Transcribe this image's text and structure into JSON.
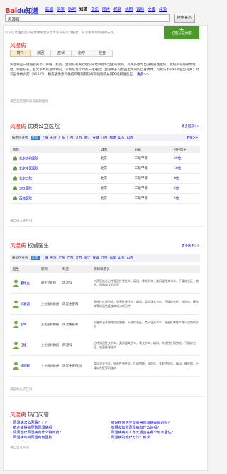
{
  "header": {
    "logo": {
      "bai": "Bai",
      "paw": "du",
      "zhidao": "知道"
    },
    "nav": [
      "新闻",
      "网页",
      "贴吧",
      "知道",
      "音乐",
      "图片",
      "视频",
      "地图",
      "百科",
      "文库",
      "经验"
    ],
    "current_nav": "知道",
    "search_value": "风湿病",
    "search_button": "搜索答案"
  },
  "intro": {
    "notice": "以下信息由百度知道健康联合多位专家权威信息整合，非常感谢对知道的支持。",
    "certify_plus": "+",
    "certify_label": "名医认证加帽",
    "title_red": "风湿病",
    "tabs": [
      "简介",
      "病因",
      "症状",
      "治疗",
      "检查"
    ],
    "description": "风湿病是一组侵犯关节、骨骼、肌肉、血管及有关软组织或结缔组织为主的疾病，其中多数为自身免疫性疾病。发病多较隐蔽而缓慢，病程较长，且大多具有遗传倾向。诊断及治疗均有一定难度；血液中多可检查出不同的自身抗体，可能与不同HLA亚型有关；对非甾体抗炎药（NSAID）、糖皮质激素和免疫抑制剂有较好的短期或长期的缓解性反应。",
    "more": "更多>>",
    "source": "来自百度百科权威编辑团队"
  },
  "hospitals": {
    "title_red": "风湿病",
    "title_rest": " 优质公立医院",
    "more": "更多医院>>",
    "filter_label": "按地区查找",
    "regions": [
      "北京",
      "上海",
      "天津",
      "广东",
      "广西",
      "江苏",
      "浙江",
      "安徽",
      "江西",
      "福建",
      "山东",
      "山西"
    ],
    "selected_region": "北京",
    "filter_more": "更多>>",
    "columns": [
      "医院",
      "城市",
      "分级",
      "好评医生"
    ],
    "rows": [
      {
        "name": "北京协和医院",
        "city": "北京",
        "level": "三级甲等",
        "docs": "29位"
      },
      {
        "name": "北京中医医院",
        "city": "北京",
        "level": "三级甲等",
        "docs": "10位"
      },
      {
        "name": "北京三院",
        "city": "北京",
        "level": "三级甲等",
        "docs": "8位"
      },
      {
        "name": "301医院",
        "city": "北京",
        "level": "三级甲等",
        "docs": "6位"
      },
      {
        "name": "西苑医院",
        "city": "北京",
        "level": "三级甲等",
        "docs": "5位"
      }
    ],
    "source": "来自好大夫在线"
  },
  "doctors": {
    "title_red": "风湿病",
    "title_rest": " 权威医生",
    "more": "更多医生>>",
    "filter_label": "按地区查找",
    "regions": [
      "北京",
      "上海",
      "天津",
      "广东",
      "广西",
      "江苏",
      "浙江",
      "安徽",
      "江西",
      "福建",
      "山东",
      "山西"
    ],
    "selected_region": "北京",
    "columns": [
      "医生",
      "职称",
      "科室",
      "资料和擅长"
    ],
    "rows": [
      {
        "name": "董怡主",
        "title": "副主任医师",
        "dept": "风湿科",
        "desc": "中西医结合治疗强直性脊柱炎，痛风，骨关节炎，类风湿性关节炎，干燥综合征，狼疮，银屑病关节炎等"
      },
      {
        "name": "刘湘源",
        "title": "主任医师教授",
        "dept": "风湿免疫科",
        "desc": "系统性红斑狼疮，强直性脊柱炎，痛风，类风湿关节炎，干燥综合征，皮肌炎，硬皮病等风湿免疫疾病的诊断治疗"
      },
      {
        "name": "彭琳",
        "title": "主任医师教授",
        "dept": "风湿免疫科",
        "desc": "白塞病及系统性红斑狼疮，干燥综合征，类风湿关节炎，强直性脊柱炎等风湿病的诊治"
      },
      {
        "name": "汪桂",
        "title": "主任医师教授",
        "dept": "风湿科",
        "desc": "治疗风湿性关节炎，类风湿关节炎，骨关节炎，痛风，系统性红斑狼疮，干燥综合征，强直性脊柱炎"
      },
      {
        "name": "徐明颖",
        "title": "主任医师教授",
        "dept": "风湿免疫内科",
        "desc": "类风湿关节炎，强直性脊柱炎，红斑狼疮，皮肌炎，多发性肌炎，痛风，硬皮病，干燥综合征等风湿病"
      }
    ],
    "source": "来自好大夫在线"
  },
  "faq": {
    "title_red": "风湿病",
    "title_rest": " 热门问答",
    "left": [
      "风湿病怎么回事？？？",
      "肩定痛得会导致风湿病吗",
      "请问治疗风湿病有什么特效药？",
      "风湿病与类风湿有何区别"
    ],
    "right": [
      "听说经常用空调会得风湿病是真的吗？",
      "有朋友知道风湿病有什么好吗？",
      "风湿病病的人冬天适合在哪个城市居住？",
      "风湿病的治疗方法？就求..."
    ],
    "source": "来自百度知道"
  },
  "colors": {
    "accent_red": "#d0201c",
    "link_blue": "#0000cc",
    "certify_green": "#4a9a29",
    "filter_blue": "#3a7dc9"
  }
}
